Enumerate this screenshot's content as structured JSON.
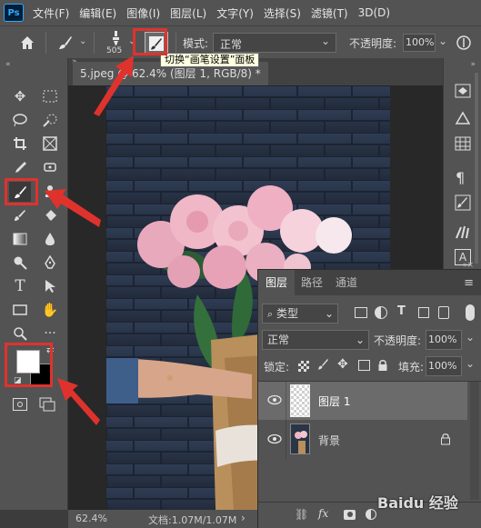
{
  "app": {
    "logo": "Ps"
  },
  "menu": {
    "items": [
      "文件(F)",
      "编辑(E)",
      "图像(I)",
      "图层(L)",
      "文字(Y)",
      "选择(S)",
      "滤镜(T)",
      "3D(D)"
    ]
  },
  "options_bar": {
    "brush_size": "505",
    "mode_label": "模式:",
    "mode_value": "正常",
    "opacity_label": "不透明度:",
    "opacity_value": "100%",
    "tooltip": "切换“画笔设置”面板"
  },
  "document": {
    "tab_title": "5.jpeg @ 62.4% (图层 1, RGB/8) *"
  },
  "status": {
    "zoom": "62.4%",
    "doc_info": "文档:1.07M/1.07M"
  },
  "layers_panel": {
    "tabs": [
      "图层",
      "路径",
      "通道"
    ],
    "filter_kind": "类型",
    "blend_mode": "正常",
    "opacity_label": "不透明度:",
    "opacity_value": "100%",
    "lock_label": "锁定:",
    "fill_label": "填充:",
    "fill_value": "100%",
    "layers": [
      {
        "name": "图层 1",
        "selected": true
      },
      {
        "name": "背景",
        "selected": false,
        "locked": true
      }
    ]
  },
  "watermark": "Baidu 经验",
  "colors": {
    "annotation": "#e0322d",
    "foreground": "#ffffff",
    "background": "#000000"
  }
}
